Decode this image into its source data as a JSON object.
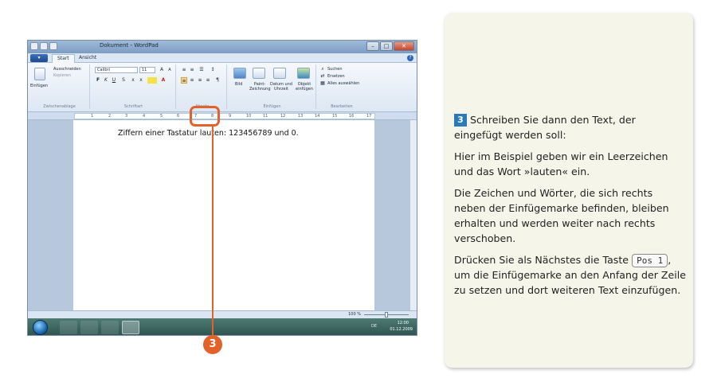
{
  "window": {
    "title": "Dokument - WordPad",
    "minimize": "–",
    "maximize": "□",
    "close": "✕",
    "help": "?"
  },
  "ribbon": {
    "app_menu": "▾",
    "tabs": [
      {
        "label": "Start",
        "active": true
      },
      {
        "label": "Ansicht",
        "active": false
      }
    ],
    "groups": {
      "clipboard": {
        "label": "Zwischenablage",
        "paste": "Einfügen",
        "cut": "Ausschneiden",
        "copy": "Kopieren"
      },
      "font": {
        "label": "Schriftart",
        "font_name": "Calibri",
        "font_size": "11",
        "bold": "F",
        "italic": "K",
        "underline": "U"
      },
      "paragraph": {
        "label": "Absatz"
      },
      "insert": {
        "label": "Einfügen",
        "picture": "Bild",
        "paint": "Paint-Zeichnung",
        "datetime": "Datum und Uhrzeit",
        "object": "Objekt einfügen"
      },
      "editing": {
        "label": "Bearbeiten",
        "find": "Suchen",
        "replace": "Ersetzen",
        "select_all": "Alles auswählen"
      }
    }
  },
  "ruler": {
    "ticks": [
      "1",
      "2",
      "3",
      "4",
      "5",
      "6",
      "7",
      "8",
      "9",
      "10",
      "11",
      "12",
      "13",
      "14",
      "15",
      "16",
      "17"
    ]
  },
  "document": {
    "text": "Ziffern einer Tastatur lauten: 123456789 und 0."
  },
  "statusbar": {
    "zoom": "100 %",
    "zoom_level_percent": 100
  },
  "taskbar": {
    "lang": "DE",
    "time": "12:00",
    "date": "01.12.2009"
  },
  "callout": {
    "number": "3",
    "color": "#e2622a"
  },
  "instructions": {
    "step": "3",
    "p1": "Schreiben Sie dann den Text, der eingefügt werden soll:",
    "p2": "Hier im Beispiel geben wir ein Leerzeichen und das Wort »lauten« ein.",
    "p3": "Die Zeichen und Wörter, die sich rechts neben der Einfügemarke befinden, bleiben erhalten und werden weiter nach rechts verschoben.",
    "p4_before": "Drücken Sie als Nächstes die Taste",
    "key": "Pos 1",
    "p4_after": ", um die Einfügemarke an den Anfang der Zeile zu setzen und dort weiteren Text einzufügen."
  },
  "colors": {
    "accent": "#e2622a",
    "step_badge": "#2a7ab8",
    "panel_bg": "#f6f5ea"
  }
}
